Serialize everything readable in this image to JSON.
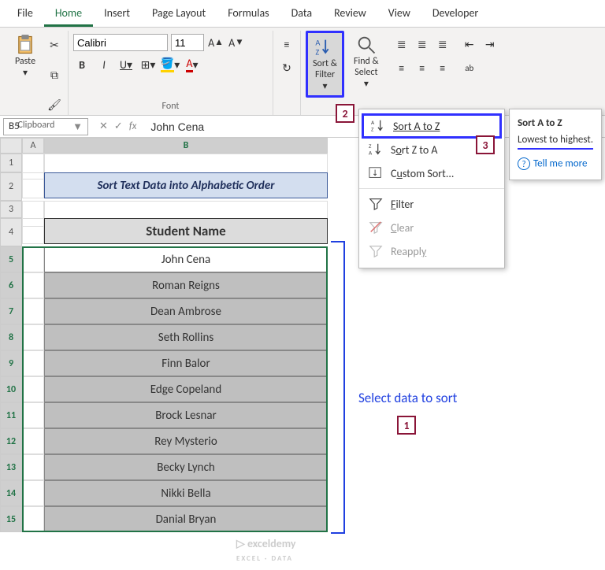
{
  "tabs": [
    "File",
    "Home",
    "Insert",
    "Page Layout",
    "Formulas",
    "Data",
    "Review",
    "View",
    "Developer"
  ],
  "active_tab": 1,
  "clipboard": {
    "paste": "Paste",
    "label": "Clipboard"
  },
  "font": {
    "name": "Calibri",
    "size": "11",
    "label": "Font"
  },
  "sortfilter": {
    "label": "Sort &\nFilter",
    "find": "Find &\nSelect"
  },
  "namebox": "B5",
  "formula_value": "John Cena",
  "cols": [
    "A",
    "B"
  ],
  "title_row": "Sort Text Data into Alphabetic Order",
  "header_row": "Student Name",
  "students": [
    "John Cena",
    "Roman Reigns",
    "Dean Ambrose",
    "Seth Rollins",
    "Finn Balor",
    "Edge Copeland",
    "Brock Lesnar",
    "Rey Mysterio",
    "Becky Lynch",
    "Nikki Bella",
    "Danial Bryan"
  ],
  "row_numbers": [
    1,
    2,
    3,
    4,
    5,
    6,
    7,
    8,
    9,
    10,
    11,
    12,
    13,
    14,
    15
  ],
  "menu": {
    "sort_az": "Sort A to Z",
    "sort_za": "Sort Z to A",
    "custom": "Custom Sort...",
    "filter": "Filter",
    "clear": "Clear",
    "reapply": "Reapply"
  },
  "tooltip": {
    "title": "Sort A to Z",
    "body": "Lowest to highest.",
    "link": "Tell me more"
  },
  "annotations": {
    "select_text": "Select data to sort",
    "n1": "1",
    "n2": "2",
    "n3": "3"
  },
  "watermark": "exceldemy"
}
